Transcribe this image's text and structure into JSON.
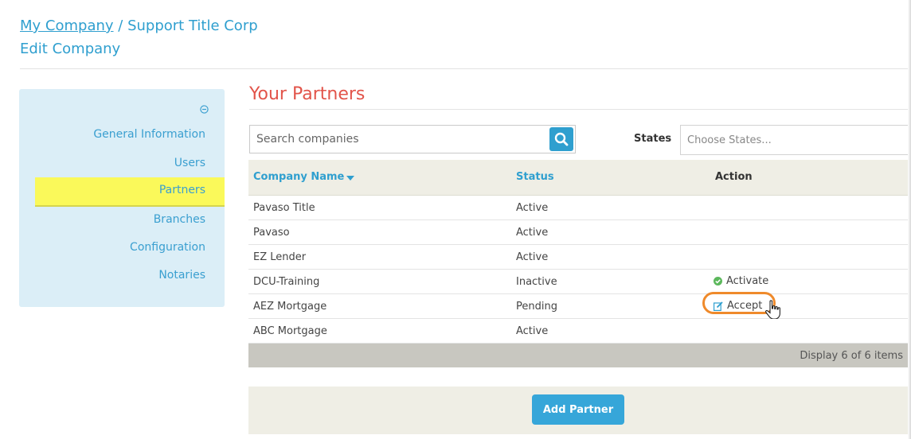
{
  "header": {
    "breadcrumb_link": "My Company",
    "breadcrumb_sep": " / ",
    "breadcrumb_current": "Support Title Corp",
    "subtitle": "Edit Company"
  },
  "sidebar": {
    "items": [
      {
        "label": "General Information"
      },
      {
        "label": "Users"
      },
      {
        "label": "Partners"
      },
      {
        "label": "Branches"
      },
      {
        "label": "Configuration"
      },
      {
        "label": "Notaries"
      }
    ],
    "active": "Partners",
    "active_color": "#faf95a"
  },
  "main": {
    "title": "Your Partners",
    "search_placeholder": "Search companies",
    "states_label": "States",
    "states_placeholder": "Choose States...",
    "columns": {
      "company": "Company Name",
      "status": "Status",
      "action": "Action"
    },
    "rows": [
      {
        "company": "Pavaso Title",
        "status": "Active",
        "action": ""
      },
      {
        "company": "Pavaso",
        "status": "Active",
        "action": ""
      },
      {
        "company": "EZ Lender",
        "status": "Active",
        "action": ""
      },
      {
        "company": "DCU-Training",
        "status": "Inactive",
        "action": "Activate",
        "action_icon": "check-circle-icon"
      },
      {
        "company": "AEZ Mortgage",
        "status": "Pending",
        "action": "Accept",
        "action_icon": "edit-icon"
      },
      {
        "company": "ABC Mortgage",
        "status": "Active",
        "action": ""
      }
    ],
    "footer_text": "Display 6 of 6 items",
    "add_button": "Add Partner"
  },
  "colors": {
    "accent": "#2f9fcf",
    "title": "#e2544a",
    "highlight_ring": "#ef8a2b",
    "check_green": "#5cb85c"
  }
}
